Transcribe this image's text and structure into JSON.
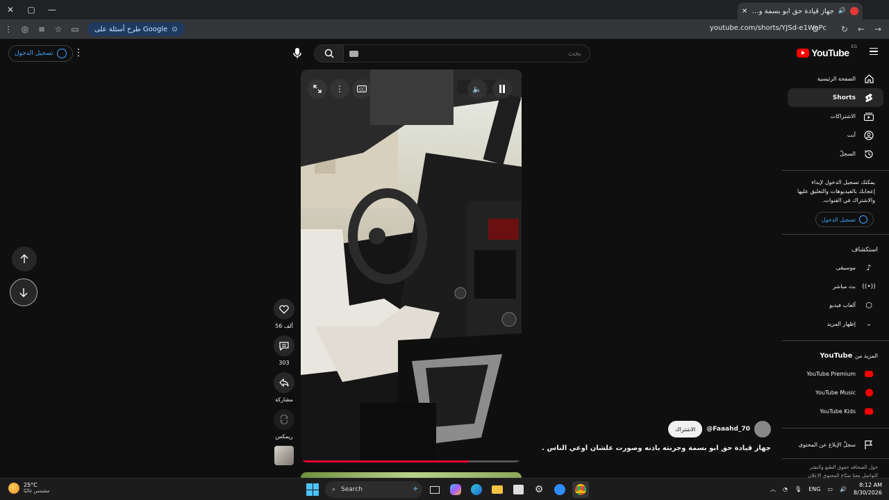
{
  "browser": {
    "tab_title": "جهاز قيادة حق ابو بسمة وجرب",
    "url": "youtube.com/shorts/YJSd-e1WoPc",
    "google_chip": "طرح أسئلة على Google"
  },
  "header": {
    "signin_label": "تسجيل الدخول",
    "search_placeholder": "بحث",
    "logo_word": "YouTube",
    "logo_country": "EG"
  },
  "sidebar": {
    "items": [
      {
        "label": "الصفحة الرئيسية",
        "icon": "home-icon"
      },
      {
        "label": "Shorts",
        "icon": "shorts-icon"
      },
      {
        "label": "الاشتراكات",
        "icon": "subscriptions-icon"
      },
      {
        "label": "أنت",
        "icon": "you-icon"
      },
      {
        "label": "السجلّ",
        "icon": "history-icon"
      }
    ],
    "signin_prompt": "يمكنك تسجيل الدخول لإبداء إعجابك بالفيديوهات والتعليق عليها والاشتراك في القنوات.",
    "signin_label": "تسجيل الدخول",
    "explore_heading": "استكشاف",
    "explore": [
      {
        "label": "موسيقى",
        "icon": "music-icon"
      },
      {
        "label": "بث مباشر",
        "icon": "live-icon"
      },
      {
        "label": "ألعاب فيديو",
        "icon": "gaming-icon"
      },
      {
        "label": "إظهار المزيد",
        "icon": "chevron-down-icon"
      }
    ],
    "more_heading_prefix": "المزيد من",
    "more_heading_brand": "YouTube",
    "more": [
      {
        "label": "YouTube Premium"
      },
      {
        "label": "YouTube Music"
      },
      {
        "label": "YouTube Kids"
      }
    ],
    "report_label": "سجلّ الإبلاغ عن المحتوى",
    "footer_line1": "حول  الصحافة  حقوق الطبع والنشر",
    "footer_line2": "التواصل معنا  صنّاع المحتوى  الإعلان"
  },
  "actions": {
    "likes": "56 ألف",
    "comments": "303",
    "share": "مشاركة",
    "remix": "ريمكس"
  },
  "channel": {
    "handle": "@Faaahd_70",
    "subscribe": "الاشتراك"
  },
  "video": {
    "title": "جهاز قيادة حق ابو بسمة وجربته باذنه وصورت علشان أوعي الناس ...",
    "progress": 0.76
  },
  "taskbar": {
    "temp": "25°C",
    "weather": "مشمس غالبًا",
    "search": "Search",
    "lang": "ENG",
    "time": "8:12 AM",
    "date": "8/30/2026"
  }
}
